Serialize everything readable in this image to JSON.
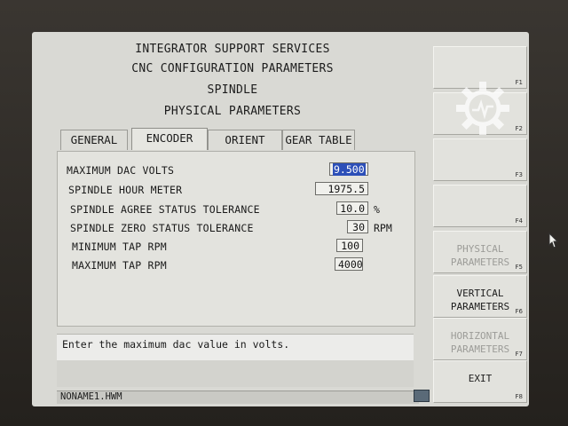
{
  "header": {
    "line1": "INTEGRATOR SUPPORT SERVICES",
    "line2": "CNC CONFIGURATION PARAMETERS",
    "line3": "SPINDLE",
    "line4": "PHYSICAL PARAMETERS"
  },
  "tabs": [
    {
      "label": "GENERAL"
    },
    {
      "label": "ENCODER"
    },
    {
      "label": "ORIENT"
    },
    {
      "label": "GEAR TABLE"
    }
  ],
  "params": [
    {
      "label": "MAXIMUM DAC VOLTS",
      "value": "9.500",
      "unit": ""
    },
    {
      "label": "SPINDLE HOUR METER",
      "value": "1975.5",
      "unit": ""
    },
    {
      "label": "SPINDLE AGREE STATUS TOLERANCE",
      "value": "10.0",
      "unit": "%"
    },
    {
      "label": "SPINDLE ZERO STATUS TOLERANCE",
      "value": "30",
      "unit": "RPM"
    },
    {
      "label": "MINIMUM TAP RPM",
      "value": "100",
      "unit": ""
    },
    {
      "label": "MAXIMUM TAP RPM",
      "value": "4000",
      "unit": ""
    }
  ],
  "message": "Enter the maximum dac value in volts.",
  "status": {
    "filename": "NONAME1.HWM"
  },
  "fkeys": [
    {
      "label": "",
      "num": "F1"
    },
    {
      "label": "",
      "num": "F2"
    },
    {
      "label": "",
      "num": "F3"
    },
    {
      "label": "",
      "num": "F4"
    },
    {
      "label": "PHYSICAL\nPARAMETERS",
      "num": "F5"
    },
    {
      "label": "VERTICAL\nPARAMETERS",
      "num": "F6"
    },
    {
      "label": "HORIZONTAL\nPARAMETERS",
      "num": "F7"
    },
    {
      "label": "EXIT",
      "num": "F8"
    }
  ],
  "icons": {
    "watermark": "gear-icon",
    "pointer": "cursor-icon",
    "keyboard": "keyboard-icon"
  }
}
